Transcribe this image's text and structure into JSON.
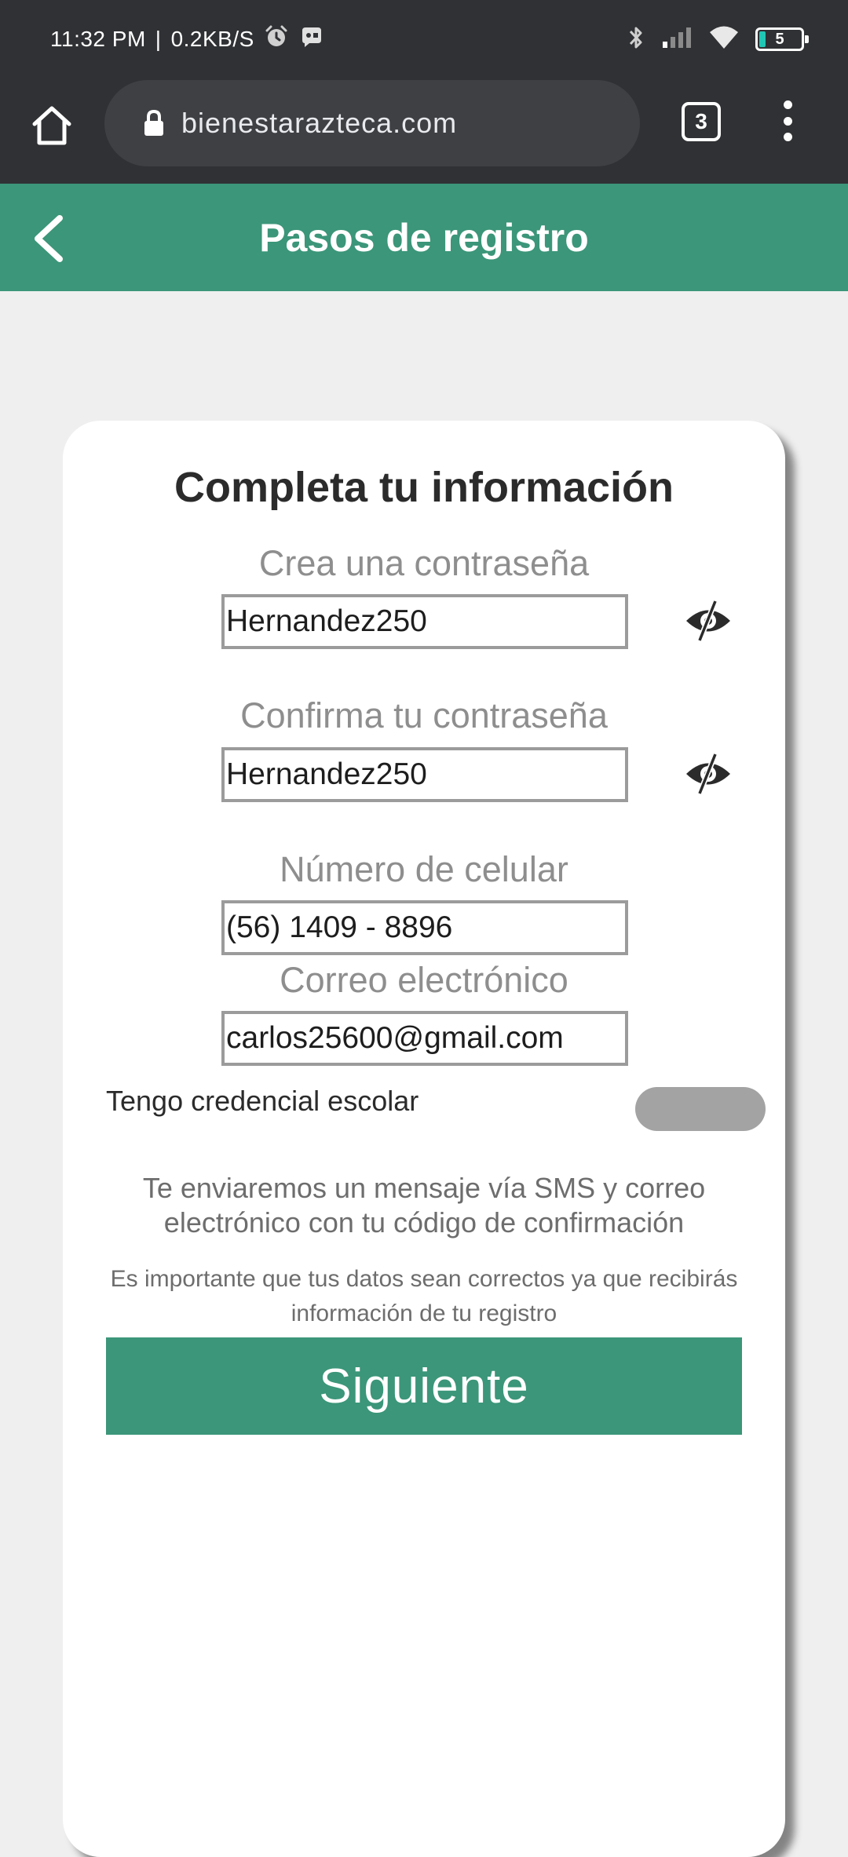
{
  "status_bar": {
    "time": "11:32 PM",
    "separator": "|",
    "speed": "0.2KB/S",
    "battery_level": "5",
    "battery_percent": 5,
    "icons": [
      "alarm-icon",
      "app-notification-icon",
      "bluetooth-icon",
      "signal-icon",
      "wifi-icon",
      "battery-icon"
    ]
  },
  "browser": {
    "url": "bienestarazteca.com",
    "tab_count": "3",
    "icons": [
      "home-icon",
      "lock-icon",
      "tabs-icon",
      "more-vert-icon"
    ]
  },
  "header": {
    "title": "Pasos de registro",
    "back_icon": "chevron-left-icon"
  },
  "form": {
    "title": "Completa tu información",
    "password": {
      "label": "Crea una contraseña",
      "value": "Hernandez250",
      "toggle_icon": "eye-slash-icon"
    },
    "confirm_password": {
      "label": "Confirma tu contraseña",
      "value": "Hernandez250",
      "toggle_icon": "eye-slash-icon"
    },
    "phone": {
      "label": "Número de celular",
      "value": "(56) 1409 - 8896"
    },
    "email": {
      "label": "Correo electrónico",
      "value": "carlos25600@gmail.com"
    },
    "school_credential": {
      "label": "Tengo credencial escolar",
      "checked": false
    },
    "sms_note": "Te enviaremos un mensaje vía SMS y correo electrónico con tu código de confirmación",
    "data_note": "Es importante que tus datos sean correctos ya que recibirás información de tu registro",
    "next_label": "Siguiente"
  },
  "colors": {
    "brand_green": "#3c9679",
    "toolbar": "#303134",
    "background": "#efefef",
    "battery": "#21c7b5"
  }
}
